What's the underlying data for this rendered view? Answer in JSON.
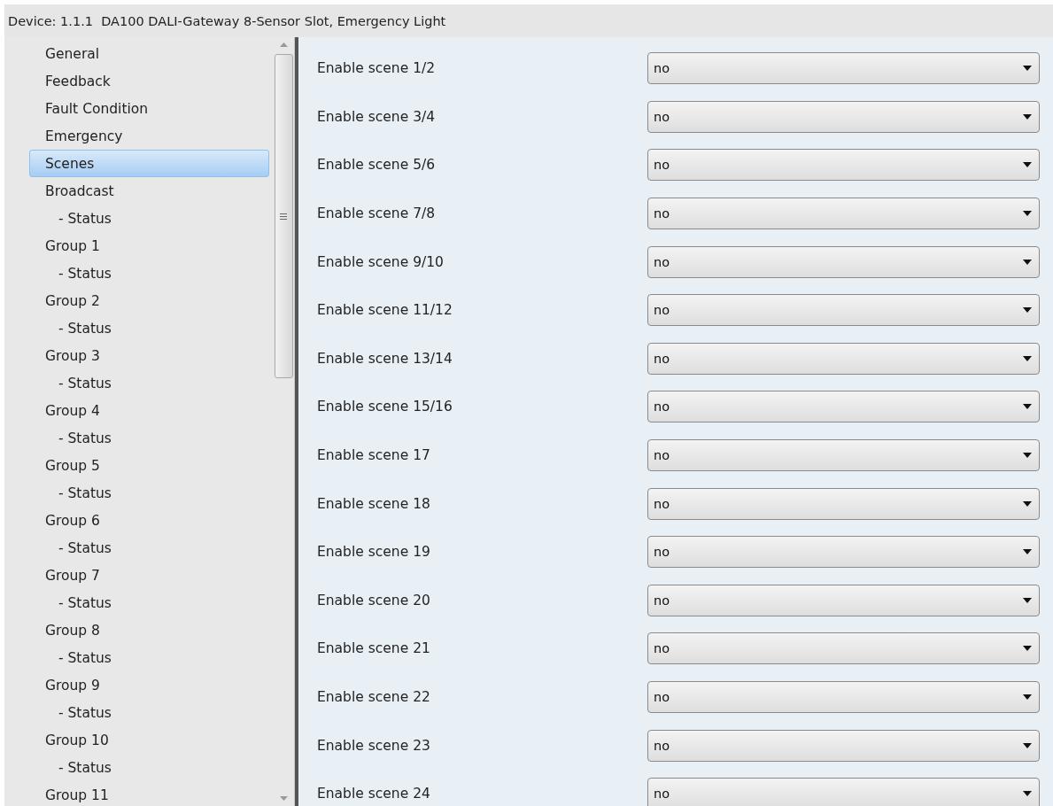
{
  "window": {
    "title": "Device: 1.1.1  DA100 DALI-Gateway 8-Sensor Slot, Emergency Light"
  },
  "sidebar": {
    "items": [
      {
        "label": "General",
        "selected": false
      },
      {
        "label": "Feedback",
        "selected": false
      },
      {
        "label": "Fault Condition",
        "selected": false
      },
      {
        "label": "Emergency",
        "selected": false
      },
      {
        "label": "Scenes",
        "selected": true
      },
      {
        "label": "Broadcast",
        "selected": false,
        "children": [
          {
            "label": "- Status",
            "selected": false
          }
        ]
      },
      {
        "label": "Group 1",
        "selected": false,
        "children": [
          {
            "label": "- Status",
            "selected": false
          }
        ]
      },
      {
        "label": "Group 2",
        "selected": false,
        "children": [
          {
            "label": "- Status",
            "selected": false
          }
        ]
      },
      {
        "label": "Group 3",
        "selected": false,
        "children": [
          {
            "label": "- Status",
            "selected": false
          }
        ]
      },
      {
        "label": "Group 4",
        "selected": false,
        "children": [
          {
            "label": "- Status",
            "selected": false
          }
        ]
      },
      {
        "label": "Group 5",
        "selected": false,
        "children": [
          {
            "label": "- Status",
            "selected": false
          }
        ]
      },
      {
        "label": "Group 6",
        "selected": false,
        "children": [
          {
            "label": "- Status",
            "selected": false
          }
        ]
      },
      {
        "label": "Group 7",
        "selected": false,
        "children": [
          {
            "label": "- Status",
            "selected": false
          }
        ]
      },
      {
        "label": "Group 8",
        "selected": false,
        "children": [
          {
            "label": "- Status",
            "selected": false
          }
        ]
      },
      {
        "label": "Group 9",
        "selected": false,
        "children": [
          {
            "label": "- Status",
            "selected": false
          }
        ]
      },
      {
        "label": "Group 10",
        "selected": false,
        "children": [
          {
            "label": "- Status",
            "selected": false
          }
        ]
      },
      {
        "label": "Group 11",
        "selected": false
      }
    ]
  },
  "settings": [
    {
      "label": "Enable scene 1/2",
      "value": "no"
    },
    {
      "label": "Enable scene 3/4",
      "value": "no"
    },
    {
      "label": "Enable scene 5/6",
      "value": "no"
    },
    {
      "label": "Enable scene 7/8",
      "value": "no"
    },
    {
      "label": "Enable scene 9/10",
      "value": "no"
    },
    {
      "label": "Enable scene 11/12",
      "value": "no"
    },
    {
      "label": "Enable scene 13/14",
      "value": "no"
    },
    {
      "label": "Enable scene 15/16",
      "value": "no"
    },
    {
      "label": "Enable scene 17",
      "value": "no"
    },
    {
      "label": "Enable scene 18",
      "value": "no"
    },
    {
      "label": "Enable scene 19",
      "value": "no"
    },
    {
      "label": "Enable scene 20",
      "value": "no"
    },
    {
      "label": "Enable scene 21",
      "value": "no"
    },
    {
      "label": "Enable scene 22",
      "value": "no"
    },
    {
      "label": "Enable scene 23",
      "value": "no"
    },
    {
      "label": "Enable scene 24",
      "value": "no"
    }
  ]
}
